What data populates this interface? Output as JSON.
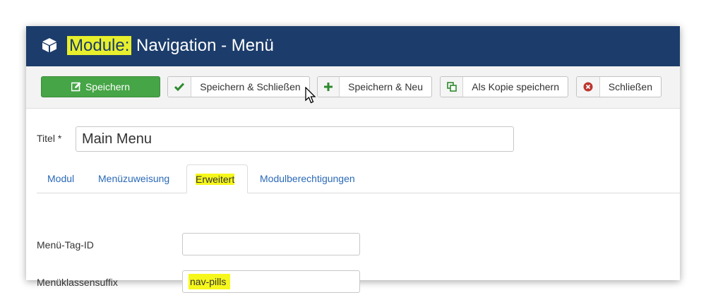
{
  "header": {
    "title_highlighted": "Module:",
    "title_rest": " Navigation - Menü",
    "icon": "cube-icon"
  },
  "toolbar": {
    "save": {
      "label": "Speichern",
      "icon": "edit-icon"
    },
    "save_close": {
      "label": "Speichern & Schließen",
      "icon": "check-icon"
    },
    "save_new": {
      "label": "Speichern & Neu",
      "icon": "plus-icon"
    },
    "save_copy": {
      "label": "Als Kopie speichern",
      "icon": "copy-icon"
    },
    "close": {
      "label": "Schließen",
      "icon": "cancel-circle-icon"
    }
  },
  "form": {
    "title_label": "Titel *",
    "title_value": "Main Menu",
    "tabs": [
      {
        "label": "Modul",
        "active": false
      },
      {
        "label": "Menüzuweisung",
        "active": false
      },
      {
        "label": "Erweitert",
        "active": true
      },
      {
        "label": "Modulberechtigungen",
        "active": false
      }
    ],
    "fields": [
      {
        "label": "Menü-Tag-ID",
        "value": ""
      },
      {
        "label": "Menüklassensuffix",
        "value": "nav-pills"
      }
    ]
  },
  "colors": {
    "header_bg": "#1c3d6b",
    "primary_green": "#46a546",
    "highlight_yellow": "#f6f71b",
    "link_blue": "#2a69b8"
  }
}
